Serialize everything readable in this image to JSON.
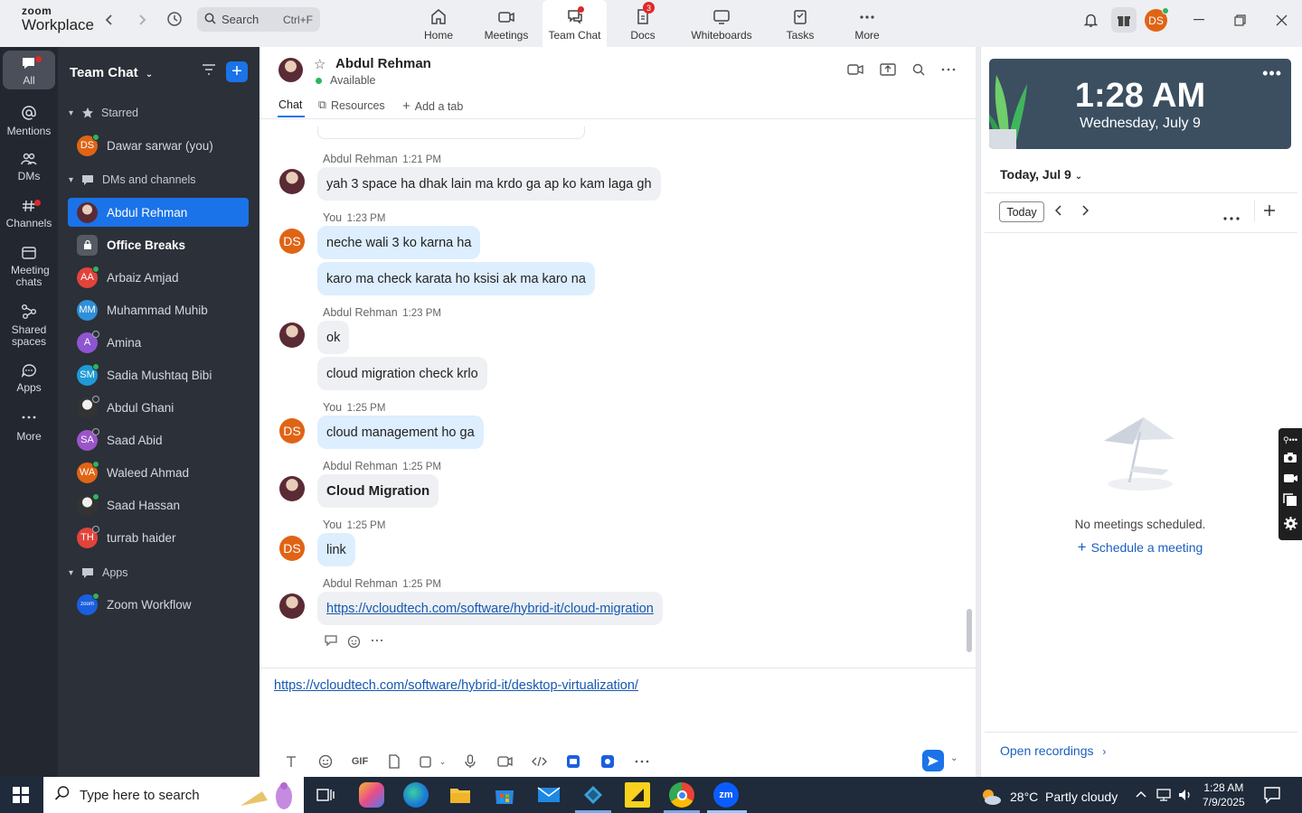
{
  "app": {
    "logo_top": "zoom",
    "logo_bottom": "Workplace"
  },
  "search": {
    "label": "Search",
    "shortcut": "Ctrl+F"
  },
  "nav_tabs": [
    {
      "label": "Home"
    },
    {
      "label": "Meetings"
    },
    {
      "label": "Team Chat"
    },
    {
      "label": "Docs",
      "badge": "3"
    },
    {
      "label": "Whiteboards"
    },
    {
      "label": "Tasks"
    },
    {
      "label": "More"
    }
  ],
  "user_avatar": "DS",
  "rail": [
    {
      "label": "All"
    },
    {
      "label": "Mentions"
    },
    {
      "label": "DMs"
    },
    {
      "label": "Channels"
    },
    {
      "label": "Meeting chats"
    },
    {
      "label": "Shared spaces"
    },
    {
      "label": "Apps"
    },
    {
      "label": "More"
    }
  ],
  "side": {
    "title": "Team Chat",
    "starred_label": "Starred",
    "starred": [
      {
        "initials": "DS",
        "name": "Dawar sarwar (you)",
        "color": "#e06415"
      }
    ],
    "dms_label": "DMs and channels",
    "dms": [
      {
        "initials": "",
        "name": "Abdul Rehman",
        "color": "photo"
      },
      {
        "initials": "",
        "name": "Office Breaks",
        "color": "#555a63"
      },
      {
        "initials": "AA",
        "name": "Arbaiz Amjad",
        "color": "#e2433b"
      },
      {
        "initials": "MM",
        "name": "Muhammad Muhib",
        "color": "#2f8fd8"
      },
      {
        "initials": "A",
        "name": "Amina",
        "color": "#8e55d0"
      },
      {
        "initials": "SM",
        "name": "Sadia Mushtaq Bibi",
        "color": "#1e9bd7"
      },
      {
        "initials": "",
        "name": "Abdul Ghani",
        "color": "photo2"
      },
      {
        "initials": "SA",
        "name": "Saad Abid",
        "color": "#9b55c8"
      },
      {
        "initials": "WA",
        "name": "Waleed Ahmad",
        "color": "#e06415"
      },
      {
        "initials": "",
        "name": "Saad Hassan",
        "color": "photo2"
      },
      {
        "initials": "TH",
        "name": "turrab haider",
        "color": "#e2433b"
      }
    ],
    "apps_label": "Apps",
    "apps": [
      {
        "initials": "zoom",
        "name": "Zoom Workflow",
        "color": "#1a5fe0"
      }
    ]
  },
  "chat": {
    "contact_name": "Abdul Rehman",
    "status": "Available",
    "tabs": {
      "chat": "Chat",
      "resources": "Resources",
      "add": "Add a tab"
    },
    "messages": [
      {
        "sender": "Abdul Rehman",
        "time": "1:21 PM",
        "texts": [
          "yah 3 space ha dhak lain ma krdo ga ap ko kam laga gh"
        ]
      },
      {
        "sender": "You",
        "time": "1:23 PM",
        "texts": [
          "neche wali 3 ko karna ha",
          "karo ma check karata ho ksisi ak ma karo na"
        ]
      },
      {
        "sender": "Abdul Rehman",
        "time": "1:23 PM",
        "texts": [
          "ok",
          "cloud migration check krlo"
        ]
      },
      {
        "sender": "You",
        "time": "1:25 PM",
        "texts": [
          "cloud management ho ga"
        ]
      },
      {
        "sender": "Abdul Rehman",
        "time": "1:25 PM",
        "texts": [
          "Cloud Migration"
        ]
      },
      {
        "sender": "You",
        "time": "1:25 PM",
        "texts": [
          "link"
        ]
      },
      {
        "sender": "Abdul Rehman",
        "time": "1:25 PM",
        "texts": [
          "https://vcloudtech.com/software/hybrid-it/cloud-migration"
        ]
      }
    ],
    "compose_text": "https://vcloudtech.com/software/hybrid-it/desktop-virtualization/"
  },
  "calendar": {
    "time": "1:28 AM",
    "date": "Wednesday, July 9",
    "today_heading": "Today, Jul 9",
    "today_button": "Today",
    "empty": "No meetings scheduled.",
    "schedule": "Schedule a meeting",
    "open_recordings": "Open recordings"
  },
  "taskbar": {
    "search_placeholder": "Type here to search",
    "weather": "28°C  Partly cloudy",
    "time": "1:28 AM",
    "date": "7/9/2025"
  }
}
